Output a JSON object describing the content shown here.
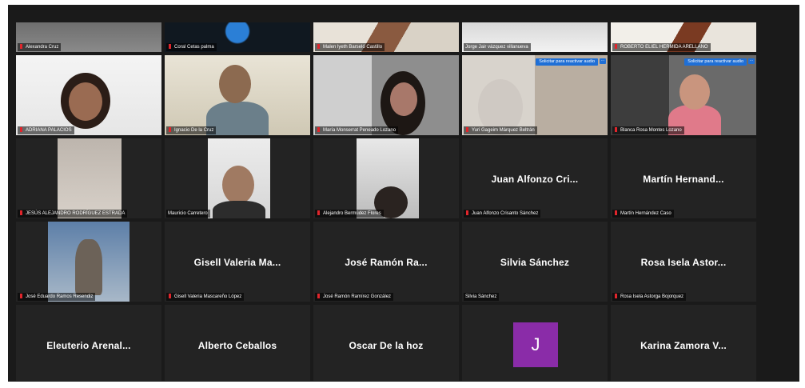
{
  "participants": {
    "row0": [
      "Alexandra Cruz",
      "Coral Cetas palma",
      "Malen lyeth Barseló Castillo",
      "Jorge Jair vázquez villanueva",
      "ROBERTO ELIEL HERMIDA ARELLANO"
    ],
    "row1": [
      "ADRIANA PALACIOS",
      "Ignacio De la Cruz",
      "María Monserrat Peneado Lozano",
      "Yuri Gageim Márquez Beltrán",
      "Blanca Rosa Montes Lozano"
    ],
    "row2": [
      "JESÚS ALEJANDRO RODRÍGUEZ ESTRADA",
      "Mauricio Carretero",
      "Alejandro Bermúdez Flores",
      "Juan Alfonzo Crisanto Sánchez",
      "Martín Hernández Caso"
    ],
    "row2_big": [
      "Juan Alfonzo Cri...",
      "Martín Hernand..."
    ],
    "row3": [
      "José Eduardo Ramos Resendiz",
      "Gisell Valeria Mascareño López",
      "José Ramón Ramírez González",
      "Silvia Sánchez",
      "Rosa Isela Astorga Bojorquez"
    ],
    "row3_big": [
      "Gisell Valeria Ma...",
      "José Ramón Ra...",
      "Silvia Sánchez",
      "Rosa Isela Astor..."
    ],
    "row4_big": [
      "Eleuterio Arenal...",
      "Alberto Ceballos",
      "Oscar De la hoz",
      "Karina Zamora V..."
    ],
    "avatar_letter": "J",
    "audio_request_label": "Solicitar para reactivar audio",
    "more_label": "···"
  },
  "colors": {
    "mute_red": "#e0252b",
    "avatar_purple": "#8a2ca8",
    "request_blue": "#1f6fd6"
  }
}
